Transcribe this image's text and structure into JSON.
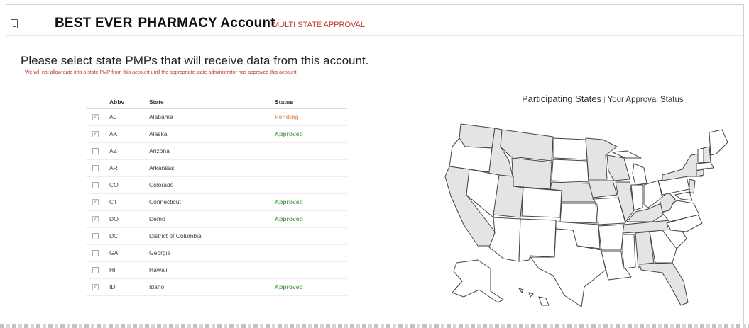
{
  "header": {
    "title_prefix": "BEST EVER",
    "title_main": "PHARMACY Account",
    "subtitle": "MULTI STATE APPROVAL"
  },
  "prompt": "Please select state PMPs that will receive data from this account.",
  "note": "We will not allow data into a state PMP from this account until the appropriate state administrator has approved this account.",
  "table": {
    "headers": {
      "abbv": "Abbv",
      "state": "State",
      "status": "Status"
    },
    "rows": [
      {
        "abbv": "AL",
        "state": "Alabama",
        "status": "Pending",
        "checked": true,
        "status_color": "#e0a070"
      },
      {
        "abbv": "AK",
        "state": "Alaska",
        "status": "Approved",
        "checked": true,
        "status_color": "#5aa05a"
      },
      {
        "abbv": "AZ",
        "state": "Arizona",
        "status": "",
        "checked": false
      },
      {
        "abbv": "AR",
        "state": "Arkansas",
        "status": "",
        "checked": false
      },
      {
        "abbv": "CO",
        "state": "Colorado",
        "status": "",
        "checked": false
      },
      {
        "abbv": "CT",
        "state": "Connecticut",
        "status": "Approved",
        "checked": true,
        "status_color": "#5aa05a"
      },
      {
        "abbv": "DO",
        "state": "Demo",
        "status": "Approved",
        "checked": true,
        "status_color": "#5aa05a"
      },
      {
        "abbv": "DC",
        "state": "District of Columbia",
        "status": "",
        "checked": false
      },
      {
        "abbv": "GA",
        "state": "Georgia",
        "status": "",
        "checked": false
      },
      {
        "abbv": "HI",
        "state": "Hawaii",
        "status": "",
        "checked": false
      },
      {
        "abbv": "ID",
        "state": "Idaho",
        "status": "Approved",
        "checked": true,
        "status_color": "#5aa05a"
      }
    ]
  },
  "map": {
    "title": "Participating States",
    "separator": "|",
    "subtitle": "Your Approval Status",
    "participating_fill": "#e4e4e4",
    "other_fill": "#ffffff"
  },
  "colors": {
    "accent_red": "#c0392b",
    "approved": "#5aa05a",
    "pending": "#e0a070"
  }
}
